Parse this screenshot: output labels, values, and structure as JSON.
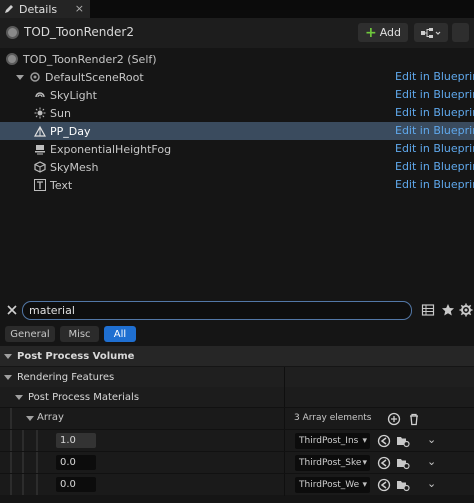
{
  "tab": {
    "title": "Details",
    "close_glyph": "×"
  },
  "header": {
    "actor_name": "TOD_ToonRender2",
    "add_label": "Add"
  },
  "tree": {
    "self_label": "TOD_ToonRender2 (Self)",
    "root_label": "DefaultSceneRoot",
    "edit_label": "Edit in Blueprint",
    "components": [
      {
        "label": "SkyLight",
        "icon": "skylight-icon"
      },
      {
        "label": "Sun",
        "icon": "sun-icon"
      },
      {
        "label": "PP_Day",
        "icon": "post-process-icon",
        "selected": true
      },
      {
        "label": "ExponentialHeightFog",
        "icon": "fog-icon"
      },
      {
        "label": "SkyMesh",
        "icon": "mesh-icon"
      },
      {
        "label": "Text",
        "icon": "text-icon"
      }
    ]
  },
  "search": {
    "value": "material"
  },
  "filters": {
    "general": "General",
    "misc": "Misc",
    "all": "All",
    "active": "All"
  },
  "properties": {
    "post_process_volume": "Post Process Volume",
    "rendering_features": "Rendering Features",
    "post_process_materials": "Post Process Materials",
    "array_label": "Array",
    "array_count": "3 Array elements",
    "elements": [
      {
        "weight": "1.0",
        "material": "ThirdPost_Ins"
      },
      {
        "weight": "0.0",
        "material": "ThirdPost_Ske"
      },
      {
        "weight": "0.0",
        "material": "ThirdPost_We"
      }
    ]
  },
  "colors": {
    "accent": "#1f6fd1",
    "selection": "#3a4b5e",
    "link": "#5fa8ec",
    "add_green": "#6fc93c"
  }
}
